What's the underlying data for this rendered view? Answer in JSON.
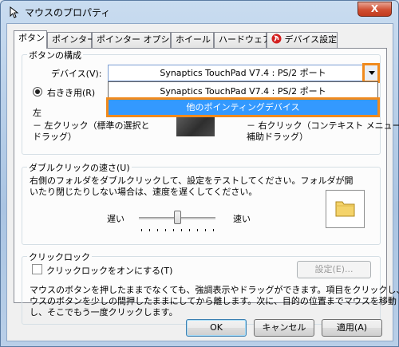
{
  "window": {
    "title": "マウスのプロパティ",
    "close_glyph": "X"
  },
  "tabs": [
    {
      "label": "ボタン",
      "active": true
    },
    {
      "label": "ポインター",
      "active": false
    },
    {
      "label": "ポインター オプション",
      "active": false
    },
    {
      "label": "ホイール",
      "active": false
    },
    {
      "label": "ハードウェア",
      "active": false
    },
    {
      "label": "デバイス設定",
      "active": false,
      "icon": "synaptics-icon"
    }
  ],
  "button_config": {
    "title": "ボタンの構成",
    "device_label": "デバイス(V):",
    "device_value": "Synaptics TouchPad V7.4 : PS/2 ポート",
    "dropdown_options": [
      "Synaptics TouchPad V7.4 : PS/2 ポート",
      "他のポインティングデバイス"
    ],
    "selected_option_index": 1,
    "right_handed_label": "右きき用(R)",
    "left_heading": "左",
    "left_line1": "－ 左クリック（標準の選択と",
    "left_line2": "ドラッグ）",
    "right_line1": "－ 右クリック（コンテキスト メニューと",
    "right_line2": "補助ドラッグ）"
  },
  "double_click": {
    "title": "ダブルクリックの速さ(U)",
    "description_line1": "右側のフォルダをダブルクリックして、設定をテストしてください。フォルダが開",
    "description_line2": "いたり閉じたりしない場合は、速度を遅くしてください。",
    "slow_label": "遅い",
    "fast_label": "速い",
    "slider_value": 0.5
  },
  "click_lock": {
    "title": "クリックロック",
    "checkbox_label": "クリックロックをオンにする(T)",
    "checked": false,
    "settings_button": "設定(E)...",
    "description_line1": "マウスのボタンを押したままでなくても、強調表示やドラッグができます。項目をクリックし、マ",
    "description_line2": "ウスのボタンを少しの間押したままにしてから離します。次に、目的の位置までマウスを移動",
    "description_line3": "し、そこでもう一度クリックします。"
  },
  "footer": {
    "ok": "OK",
    "cancel": "キャンセル",
    "apply": "適用(A)"
  },
  "colors": {
    "highlight_outline": "#f08a1d",
    "selection": "#3399ff",
    "close_button": "#c9442a"
  }
}
